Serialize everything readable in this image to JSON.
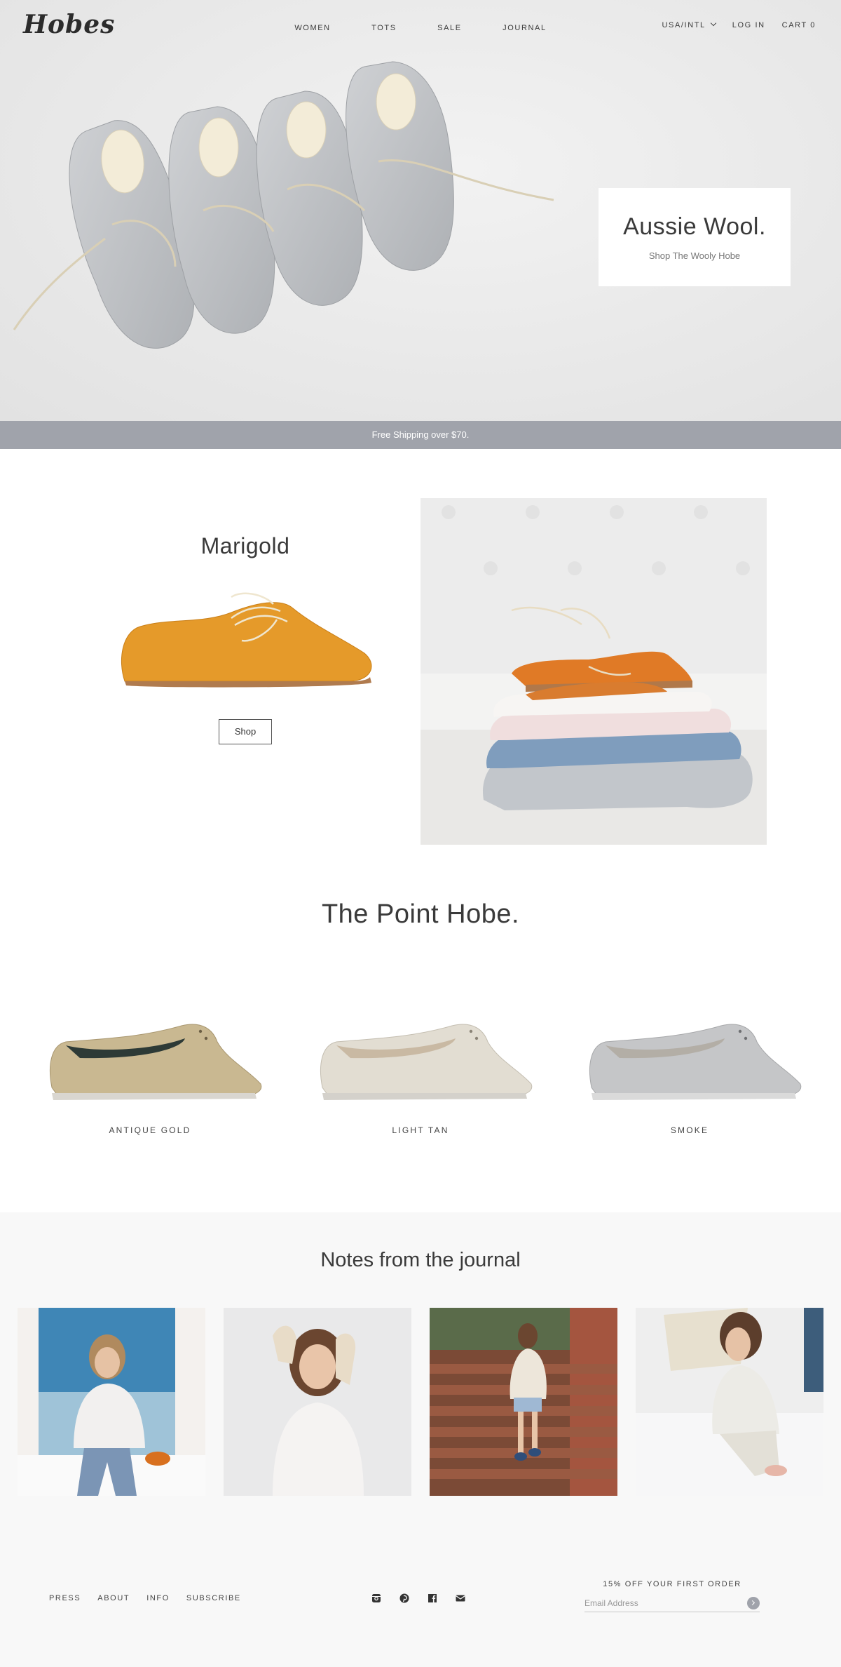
{
  "header": {
    "logo": "Hobes",
    "nav": [
      "WOMEN",
      "TOTS",
      "SALE",
      "JOURNAL"
    ],
    "region": "USA/INTL",
    "login": "LOG IN",
    "cart": "CART 0"
  },
  "hero": {
    "heading": "Aussie Wool.",
    "link": "Shop The Wooly Hobe"
  },
  "shipping_bar": "Free Shipping over $70.",
  "feature": {
    "title": "Marigold",
    "button": "Shop"
  },
  "point_hobe": {
    "title": "The Point Hobe.",
    "products": [
      {
        "label": "ANTIQUE GOLD",
        "color": "#c9b891"
      },
      {
        "label": "LIGHT TAN",
        "color": "#e2ddd2"
      },
      {
        "label": "SMOKE",
        "color": "#c5c6c8"
      }
    ]
  },
  "journal": {
    "title": "Notes from the journal"
  },
  "footer": {
    "links": [
      "PRESS",
      "ABOUT",
      "INFO",
      "SUBSCRIBE"
    ],
    "social": [
      "instagram-icon",
      "pinterest-icon",
      "facebook-icon",
      "email-icon"
    ],
    "promo": "15% OFF YOUR FIRST ORDER",
    "email_placeholder": "Email Address"
  },
  "colors": {
    "accent_gray": "#a0a3ab",
    "marigold": "#e59a2a"
  }
}
